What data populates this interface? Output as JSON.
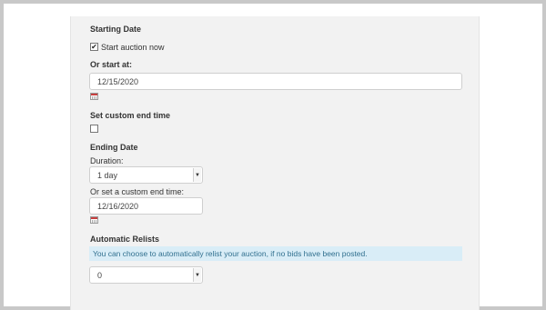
{
  "form": {
    "starting_date_heading": "Starting Date",
    "start_now_label": "Start auction now",
    "start_now_checked": true,
    "or_start_at_heading": "Or start at:",
    "start_date_value": "12/15/2020",
    "custom_end_heading": "Set custom end time",
    "custom_end_checked": false,
    "ending_date_heading": "Ending Date",
    "duration_label": "Duration:",
    "duration_value": "1 day",
    "custom_end_label": "Or set a custom end time:",
    "end_date_value": "12/16/2020",
    "relists_heading": "Automatic Relists",
    "relists_info": "You can choose to automatically relist your auction, if no bids have been posted.",
    "relists_value": "0"
  },
  "icons": {
    "checkmark": "✔",
    "dropdown_arrow": "▼",
    "calendar": "calendar-icon"
  }
}
